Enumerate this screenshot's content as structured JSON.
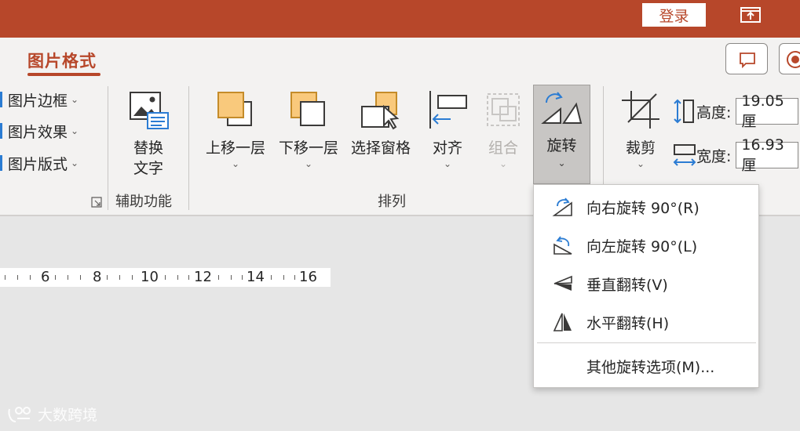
{
  "titlebar": {
    "login_label": "登录",
    "accent_color": "#b7472a"
  },
  "ribbon": {
    "active_tab": "图片格式",
    "left_items": [
      {
        "label": "图片边框",
        "icon": "picture-border-icon"
      },
      {
        "label": "图片效果",
        "icon": "picture-effects-icon"
      },
      {
        "label": "图片版式",
        "icon": "picture-layout-icon"
      }
    ],
    "accessibility": {
      "alt_text_line1": "替换",
      "alt_text_line2": "文字",
      "group_label": "辅助功能"
    },
    "arrange": {
      "group_label": "排列",
      "bring_forward": "上移一层",
      "send_backward": "下移一层",
      "selection_pane": "选择窗格",
      "align": "对齐",
      "group": "组合",
      "rotate": "旋转"
    },
    "crop": "裁剪",
    "size": {
      "height_label": "高度:",
      "height_value": "19.05 厘",
      "width_label": "宽度:",
      "width_value": "16.93 厘"
    }
  },
  "ruler": {
    "labels": [
      "6",
      "8",
      "10",
      "12",
      "14",
      "16"
    ]
  },
  "rotate_menu": {
    "items": [
      {
        "label": "向右旋转 90°(R)",
        "icon": "rotate-right-icon"
      },
      {
        "label": "向左旋转 90°(L)",
        "icon": "rotate-left-icon"
      },
      {
        "label": "垂直翻转(V)",
        "icon": "flip-vertical-icon"
      },
      {
        "label": "水平翻转(H)",
        "icon": "flip-horizontal-icon"
      },
      {
        "label": "其他旋转选项(M)..."
      }
    ]
  },
  "watermark": {
    "text": "大数跨境"
  }
}
